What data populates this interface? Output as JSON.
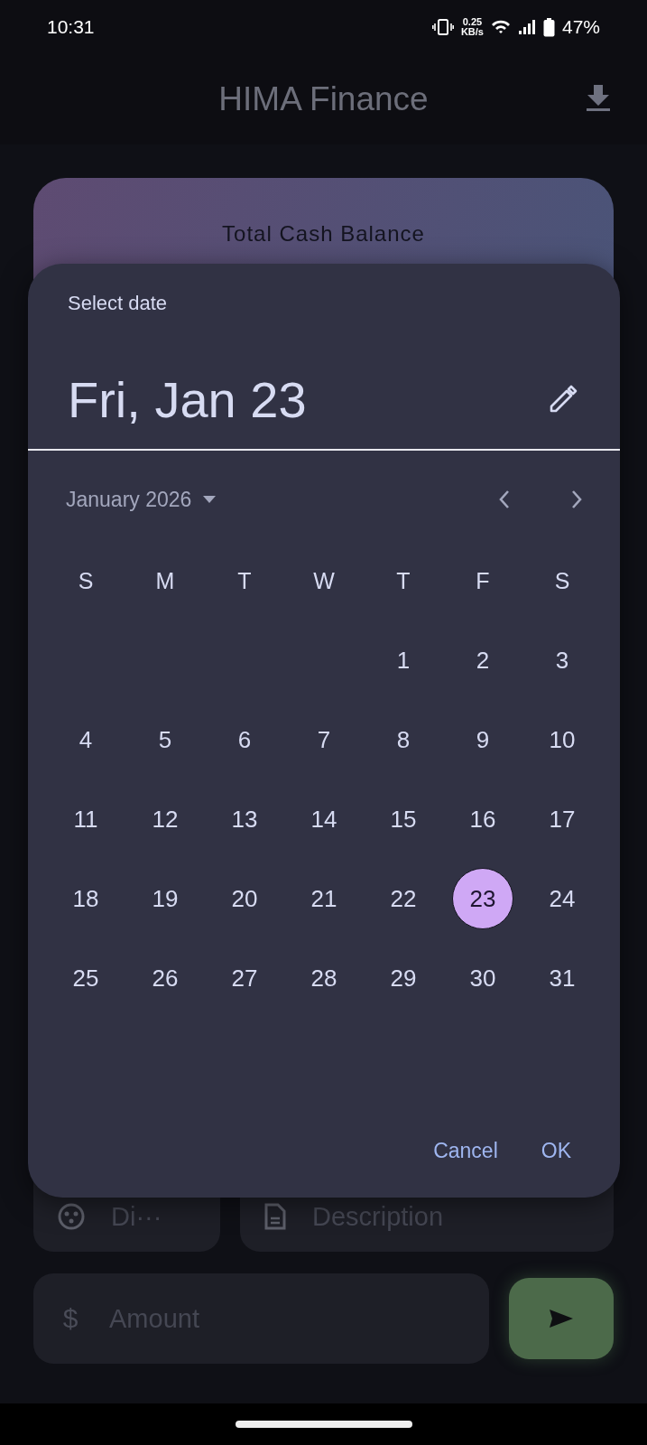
{
  "status_bar": {
    "time": "10:31",
    "net_speed_value": "0.25",
    "net_speed_unit": "KB/s",
    "battery": "47%"
  },
  "app_bar": {
    "title": "HIMA Finance"
  },
  "balance_card": {
    "title": "Total Cash Balance"
  },
  "form": {
    "category_placeholder": "Di···",
    "description_placeholder": "Description",
    "amount_placeholder": "Amount",
    "currency_symbol": "$"
  },
  "date_picker": {
    "heading": "Select date",
    "selected_date": "Fri, Jan 23",
    "month_label": "January 2026",
    "weekdays": [
      "S",
      "M",
      "T",
      "W",
      "T",
      "F",
      "S"
    ],
    "weeks": [
      {
        "days": [
          {
            "label": "1",
            "selected": false
          },
          {
            "label": "2",
            "selected": false
          },
          {
            "label": "3",
            "selected": false
          }
        ]
      },
      {
        "days": [
          {
            "label": "4",
            "selected": false
          },
          {
            "label": "5",
            "selected": false
          },
          {
            "label": "6",
            "selected": false
          },
          {
            "label": "7",
            "selected": false
          },
          {
            "label": "8",
            "selected": false
          },
          {
            "label": "9",
            "selected": false
          },
          {
            "label": "10",
            "selected": false
          }
        ]
      },
      {
        "days": [
          {
            "label": "11",
            "selected": false
          },
          {
            "label": "12",
            "selected": false
          },
          {
            "label": "13",
            "selected": false
          },
          {
            "label": "14",
            "selected": false
          },
          {
            "label": "15",
            "selected": false
          },
          {
            "label": "16",
            "selected": false
          },
          {
            "label": "17",
            "selected": false
          }
        ]
      },
      {
        "days": [
          {
            "label": "18",
            "selected": false
          },
          {
            "label": "19",
            "selected": false
          },
          {
            "label": "20",
            "selected": false
          },
          {
            "label": "21",
            "selected": false
          },
          {
            "label": "22",
            "selected": false
          },
          {
            "label": "23",
            "selected": true
          },
          {
            "label": "24",
            "selected": false
          }
        ]
      },
      {
        "days": [
          {
            "label": "25",
            "selected": false
          },
          {
            "label": "26",
            "selected": false
          },
          {
            "label": "27",
            "selected": false
          },
          {
            "label": "28",
            "selected": false
          },
          {
            "label": "29",
            "selected": false
          },
          {
            "label": "30",
            "selected": false
          },
          {
            "label": "31",
            "selected": false
          }
        ]
      }
    ],
    "buttons": [
      "Cancel",
      "OK"
    ]
  }
}
